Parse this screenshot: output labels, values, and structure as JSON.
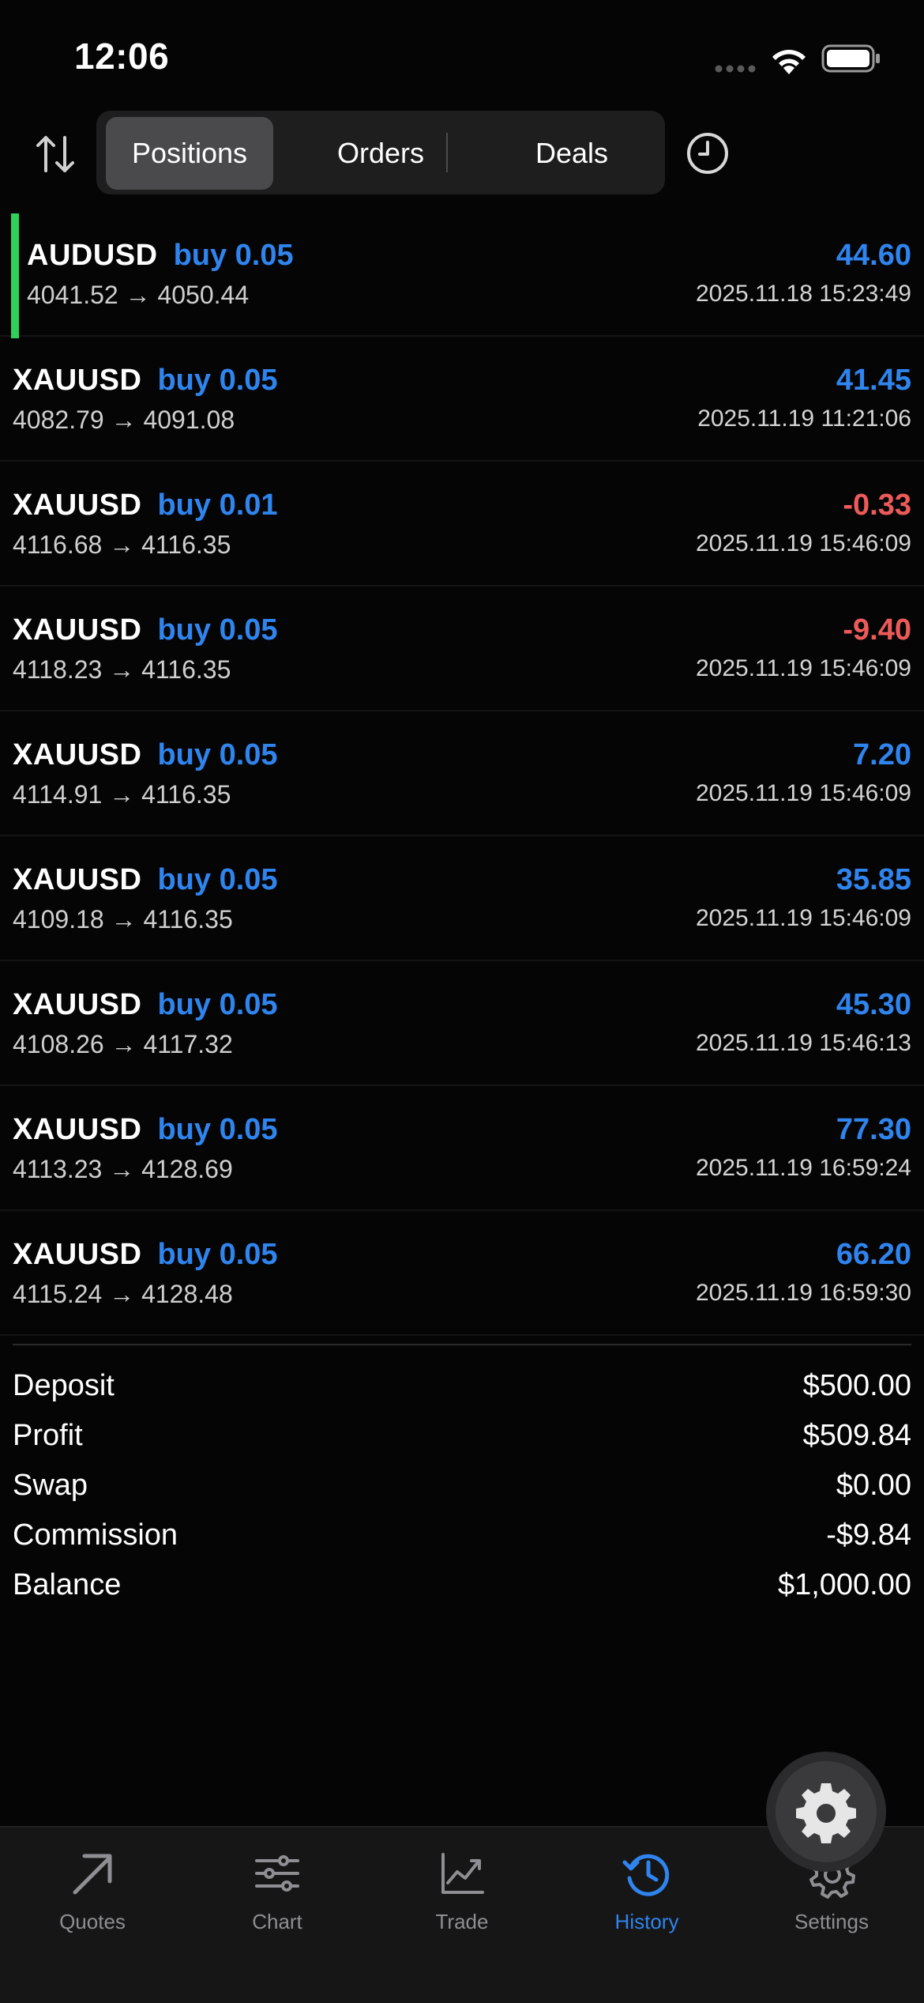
{
  "status_bar": {
    "time": "12:06"
  },
  "segments": {
    "positions": "Positions",
    "orders": "Orders",
    "deals": "Deals"
  },
  "deals": [
    {
      "symbol": "AUDUSD",
      "side": "buy 0.05",
      "prices": "4041.52 → 4050.44",
      "profit": "44.60",
      "profit_sign": "pos",
      "time": "2025.11.18 15:23:49"
    },
    {
      "symbol": "XAUUSD",
      "side": "buy 0.05",
      "prices": "4082.79 → 4091.08",
      "profit": "41.45",
      "profit_sign": "pos",
      "time": "2025.11.19 11:21:06"
    },
    {
      "symbol": "XAUUSD",
      "side": "buy 0.01",
      "prices": "4116.68 → 4116.35",
      "profit": "-0.33",
      "profit_sign": "neg",
      "time": "2025.11.19 15:46:09"
    },
    {
      "symbol": "XAUUSD",
      "side": "buy 0.05",
      "prices": "4118.23 → 4116.35",
      "profit": "-9.40",
      "profit_sign": "neg",
      "time": "2025.11.19 15:46:09"
    },
    {
      "symbol": "XAUUSD",
      "side": "buy 0.05",
      "prices": "4114.91 → 4116.35",
      "profit": "7.20",
      "profit_sign": "pos",
      "time": "2025.11.19 15:46:09"
    },
    {
      "symbol": "XAUUSD",
      "side": "buy 0.05",
      "prices": "4109.18 → 4116.35",
      "profit": "35.85",
      "profit_sign": "pos",
      "time": "2025.11.19 15:46:09"
    },
    {
      "symbol": "XAUUSD",
      "side": "buy 0.05",
      "prices": "4108.26 → 4117.32",
      "profit": "45.30",
      "profit_sign": "pos",
      "time": "2025.11.19 15:46:13"
    },
    {
      "symbol": "XAUUSD",
      "side": "buy 0.05",
      "prices": "4113.23 → 4128.69",
      "profit": "77.30",
      "profit_sign": "pos",
      "time": "2025.11.19 16:59:24"
    },
    {
      "symbol": "XAUUSD",
      "side": "buy 0.05",
      "prices": "4115.24 → 4128.48",
      "profit": "66.20",
      "profit_sign": "pos",
      "time": "2025.11.19 16:59:30"
    }
  ],
  "summary": [
    {
      "label": "Deposit",
      "value": "$500.00"
    },
    {
      "label": "Profit",
      "value": "$509.84"
    },
    {
      "label": "Swap",
      "value": "$0.00"
    },
    {
      "label": "Commission",
      "value": "-$9.84"
    },
    {
      "label": "Balance",
      "value": "$1,000.00"
    }
  ],
  "tabs": {
    "quotes": "Quotes",
    "chart": "Chart",
    "trade": "Trade",
    "history": "History",
    "settings": "Settings"
  },
  "colors": {
    "accent_blue": "#2f84ee",
    "loss_red": "#ee5a5a",
    "selection_green": "#2fd15a",
    "background": "#050505"
  },
  "icons": {
    "sort": "sort-arrows-icon",
    "period": "clock-icon",
    "quotes": "arrow-up-right-icon",
    "chart": "sliders-icon",
    "trade": "line-chart-icon",
    "history": "history-clock-icon",
    "settings": "gear-icon"
  }
}
